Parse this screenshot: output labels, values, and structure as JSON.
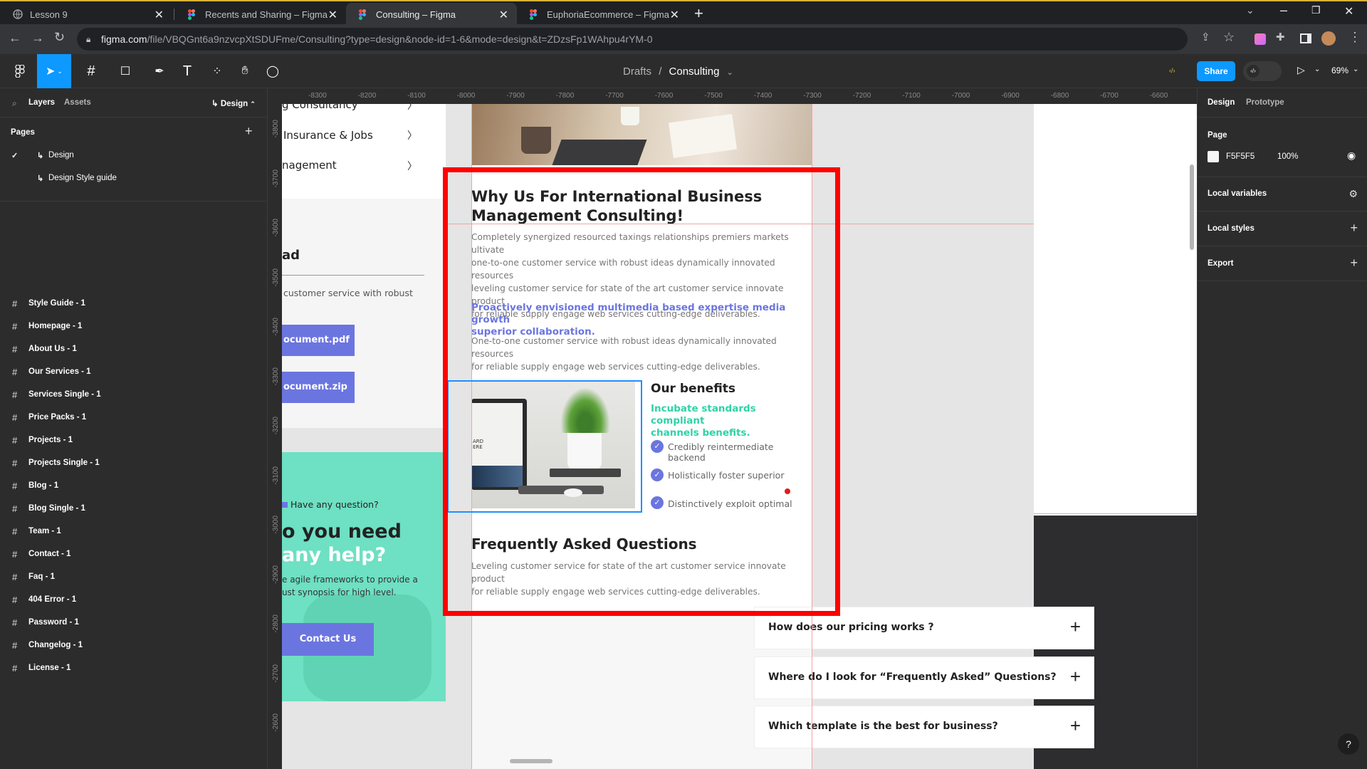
{
  "browser": {
    "tabs": [
      {
        "title": "Lesson 9"
      },
      {
        "title": "Recents and Sharing – Figma"
      },
      {
        "title": "Consulting – Figma"
      },
      {
        "title": "EuphoriaEcommerce – Figma"
      }
    ],
    "url_host": "figma.com",
    "url_path": "/file/VBQGnt6a9nzvcpXtSDUFme/Consulting?type=design&node-id=1-6&mode=design&t=ZDzsFp1WAhpu4rYM-0"
  },
  "toolbar": {
    "breadcrumb_parent": "Drafts",
    "breadcrumb_sep": "/",
    "file_name": "Consulting",
    "share_label": "Share",
    "zoom": "69%"
  },
  "left_panel": {
    "tab_layers": "Layers",
    "tab_assets": "Assets",
    "design_menu": "Design",
    "pages_header": "Pages",
    "pages": [
      {
        "label": "Design",
        "active": true
      },
      {
        "label": "Design Style guide",
        "active": false
      }
    ],
    "frames": [
      "Style Guide - 1",
      "Homepage - 1",
      "About Us - 1",
      "Our Services - 1",
      "Services Single - 1",
      "Price Packs - 1",
      "Projects - 1",
      "Projects Single - 1",
      "Blog - 1",
      "Blog Single - 1",
      "Team - 1",
      "Contact - 1",
      "Faq - 1",
      "404 Error - 1",
      "Password - 1",
      "Changelog - 1",
      "License - 1"
    ]
  },
  "rulers": {
    "top": [
      "-8300",
      "-8200",
      "-8100",
      "-8000",
      "-7900",
      "-7800",
      "-7700",
      "-7600",
      "-7500",
      "-7400",
      "-7300",
      "-7200",
      "-7100",
      "-7000",
      "-6900",
      "-6800",
      "-6700",
      "-6600"
    ],
    "left": [
      "-3800",
      "-3700",
      "-3600",
      "-3500",
      "-3400",
      "-3300",
      "-3200",
      "-3100",
      "-3000",
      "-2900",
      "-2800",
      "-2700",
      "-2600"
    ]
  },
  "right_panel": {
    "tab_design": "Design",
    "tab_prototype": "Prototype",
    "page_title": "Page",
    "page_color": "F5F5F5",
    "page_opacity": "100%",
    "local_variables": "Local variables",
    "local_styles": "Local styles",
    "export": "Export"
  },
  "canvas": {
    "sidebar_links": [
      "g Consultancy",
      "Insurance & Jobs",
      "nagement"
    ],
    "download_title": "ad",
    "download_text": "customer service with robust",
    "btn_pdf": "ocument.pdf",
    "btn_zip": "ocument.zip",
    "cta_tag": "Have any question?",
    "cta_heading_1": "o you need",
    "cta_heading_2": "any help?",
    "cta_text_1": "e agile frameworks to provide a",
    "cta_text_2": "ust synopsis for high level.",
    "cta_button": "Contact Us",
    "why_title_1": "Why Us For International Business",
    "why_title_2": "Management Consulting!",
    "why_paragraph": [
      "Completely synergized resourced taxings relationships premiers markets ultivate",
      "one-to-one customer service with robust ideas dynamically innovated resources",
      "leveling customer service for state of the art  customer service innovate product",
      "for reliable supply engage web services cutting-edge deliverables."
    ],
    "highlight_1": "Proactively envisioned multimedia based expertise media growth",
    "highlight_2": "superior collaboration.",
    "second_paragraph": [
      "One-to-one customer service with robust ideas dynamically innovated resources",
      "for reliable supply engage web services cutting-edge deliverables."
    ],
    "benefits_title": "Our benefits",
    "benefits_sub_1": "Incubate standards compliant",
    "benefits_sub_2": "channels benefits.",
    "benefits": [
      "Credibly reintermediate backend",
      "Holistically foster superior",
      "Distinctively exploit optimal"
    ],
    "laptop_screen_text": "ARD\nERE",
    "faq_title": "Frequently Asked Questions",
    "faq_paragraph": [
      "Leveling customer service for state of the art  customer service innovate product",
      "for reliable supply engage web services cutting-edge deliverables."
    ],
    "faq_items": [
      "How does our pricing works ?",
      "Where do I look for “Frequently Asked” Questions?",
      "Which template is the best for business?"
    ]
  },
  "colors": {
    "accent": "#0d99ff",
    "brand_purple": "#6b75e0",
    "brand_teal": "#2ed3a6",
    "highlight_box": "#ff0000"
  }
}
